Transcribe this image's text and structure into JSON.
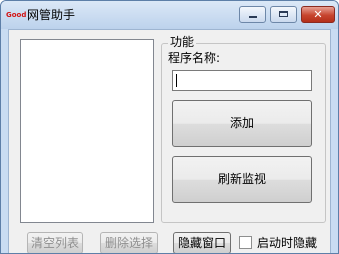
{
  "window": {
    "title": "网管助手",
    "icon_text": "Good",
    "controls": {
      "minimize": "minimize",
      "maximize": "maximize",
      "close": "✕"
    }
  },
  "function_group": {
    "title": "功能",
    "program_name_label": "程序名称:",
    "program_name_value": "",
    "add_label": "添加",
    "refresh_label": "刷新监视"
  },
  "bottom_bar": {
    "clear_list_label": "清空列表",
    "delete_selection_label": "删除选择",
    "hide_window_label": "隐藏窗口",
    "hide_on_start_label": "启动时隐藏",
    "hide_on_start_checked": false
  },
  "colors": {
    "title_bar": "#c9dcf2",
    "close_button": "#c7452f",
    "app_icon_text": "#d21414"
  }
}
